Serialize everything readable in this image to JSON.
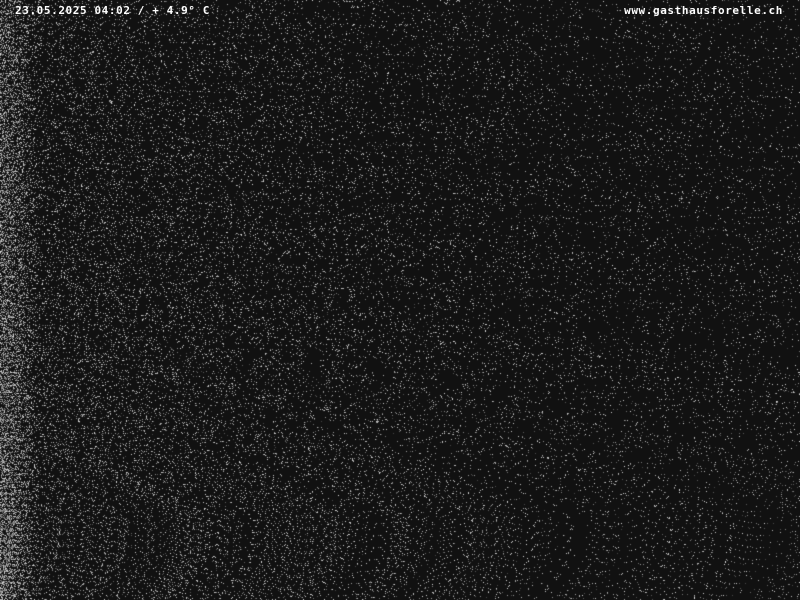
{
  "webcam": {
    "timestamp_temperature": "23.05.2025 04:02 / + 4.9° C",
    "website": "www.gasthausforelle.ch"
  },
  "colors": {
    "background": "#111111",
    "noise": "#bfbfbf",
    "text": "#ffffff"
  }
}
